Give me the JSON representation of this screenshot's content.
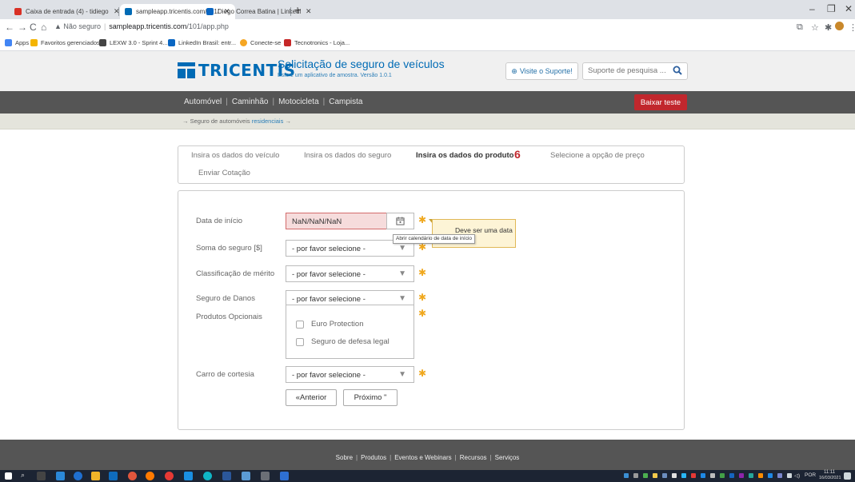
{
  "browser": {
    "tabs": [
      {
        "title": "Caixa de entrada (4) - tidiegobsr",
        "icon": "gmail-icon",
        "color": "#d93025"
      },
      {
        "title": "sampleapp.tricentis.com/101/ap",
        "icon": "tricentis-icon",
        "color": "#006bb5"
      },
      {
        "title": "Diego Correa Batina | LinkedIn",
        "icon": "linkedin-icon",
        "color": "#0a66c2"
      }
    ],
    "address": {
      "security": "Não seguro",
      "host": "sampleapp.tricentis.com",
      "path": "/101/app.php"
    },
    "bookmarks": [
      {
        "label": "Apps",
        "color": "#4285f4"
      },
      {
        "label": "Favoritos gerenciados",
        "color": "#f4b400"
      },
      {
        "label": "LEXW 3.0 - Sprint 4...",
        "color": "#444"
      },
      {
        "label": "LinkedIn Brasil: entr...",
        "color": "#0a66c2"
      },
      {
        "label": "Conecte-se",
        "color": "#f5a623"
      },
      {
        "label": "Tecnotronics - Loja...",
        "color": "#c62828"
      }
    ]
  },
  "header": {
    "logo": "TRICENTIS",
    "app_title": "Solicitação de seguro de veículos",
    "app_subtitle": "Este é um aplicativo de amostra. Versão 1.0.1",
    "support_label": "Visite o Suporte!",
    "search_placeholder": "Suporte de pesquisa ..."
  },
  "nav": {
    "items": [
      "Automóvel",
      "Caminhão",
      "Motocicleta",
      "Campista"
    ],
    "download_label": "Baixar teste"
  },
  "breadcrumb": {
    "prefix": "Seguro de automóveis",
    "highlight": "residenciais"
  },
  "steps": {
    "items": [
      "Insira os dados do veículo",
      "Insira os dados do seguro",
      "Insira os dados do produto",
      "Selecione a opção de preço",
      "Enviar Cotação"
    ],
    "active_index": 2,
    "active_count": "6"
  },
  "form": {
    "start_date_label": "Data de início",
    "start_date_value": "NaN/NaN/NaN",
    "calendar_title": "Abrir calendário de data de início",
    "validation_line1": "Deve ser uma data",
    "validation_line2": "a",
    "sum_label": "Soma do seguro [$]",
    "sum_value": "- por favor selecione -",
    "merit_label": "Classificação de mérito",
    "merit_value": "- por favor selecione -",
    "damage_label": "Seguro de Danos",
    "damage_value": "- por favor selecione -",
    "optional_label": "Produtos Opcionais",
    "optional_items": [
      "Euro Protection",
      "Seguro de defesa legal"
    ],
    "courtesy_label": "Carro de cortesia",
    "courtesy_value": "- por favor selecione -",
    "required_mark": "✱",
    "prev_label": "«Anterior",
    "next_label": "Próximo \""
  },
  "footer": {
    "links": [
      "Sobre",
      "Produtos",
      "Eventos e Webinars",
      "Recursos",
      "Serviços"
    ]
  },
  "taskbar": {
    "lang": "POR",
    "time": "11:11",
    "date": "16/03/2021"
  }
}
